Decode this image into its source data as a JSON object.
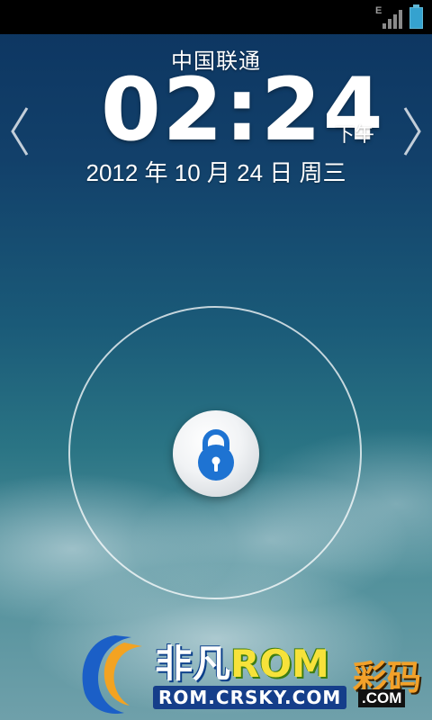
{
  "status_bar": {
    "network_type": "E",
    "icons": [
      "signal-icon",
      "battery-icon"
    ]
  },
  "lockscreen": {
    "carrier": "中国联通",
    "time": "02:24",
    "ampm": "下午",
    "date": "2012 年 10 月 24 日 周三"
  },
  "navigation": {
    "left_icon": "chevron-left-icon",
    "right_icon": "chevron-right-icon"
  },
  "unlock": {
    "icon": "lock-icon"
  },
  "watermark": {
    "title_prefix": "非凡",
    "title_rom": "ROM",
    "side_text": "彩码",
    "url": "ROM.CRSKY.COM",
    "side_url": ".COM"
  },
  "colors": {
    "status_bar": "#000000",
    "battery": "#35a2cf",
    "lock_blue": "#1e73d2"
  }
}
